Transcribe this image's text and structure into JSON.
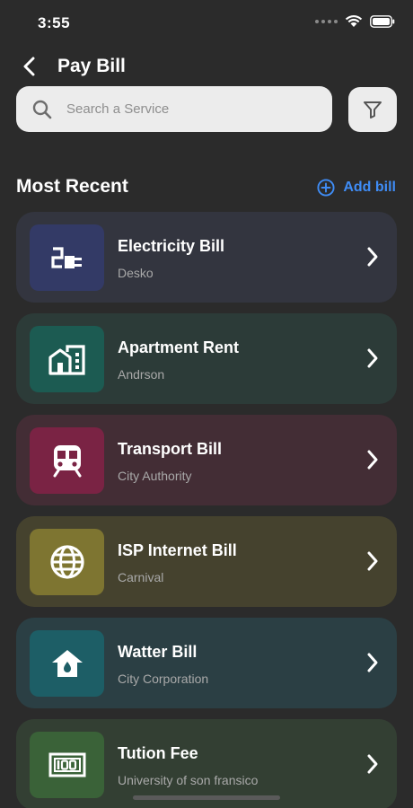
{
  "status": {
    "time": "3:55"
  },
  "header": {
    "title": "Pay Bill"
  },
  "search": {
    "placeholder": "Search a Service"
  },
  "section": {
    "title": "Most Recent",
    "add_label": "Add bill"
  },
  "colors": {
    "accent": "#3f8cf5",
    "background": "#2b2b2b"
  },
  "bills": [
    {
      "name": "Electricity Bill",
      "provider": "Desko",
      "icon": "electric-plug-icon",
      "card_color": "#33353f",
      "icon_color": "#333a66"
    },
    {
      "name": "Apartment Rent",
      "provider": "Andrson",
      "icon": "apartment-icon",
      "card_color": "#2c3b38",
      "icon_color": "#1c5b52"
    },
    {
      "name": "Transport Bill",
      "provider": "City Authority",
      "icon": "train-icon",
      "card_color": "#432d35",
      "icon_color": "#7a2344"
    },
    {
      "name": "ISP Internet Bill",
      "provider": "Carnival",
      "icon": "globe-icon",
      "card_color": "#45422e",
      "icon_color": "#7e7531"
    },
    {
      "name": "Watter Bill",
      "provider": "City Corporation",
      "icon": "water-house-icon",
      "card_color": "#2b3f44",
      "icon_color": "#1d5e66"
    },
    {
      "name": "Tution Fee",
      "provider": "University of son fransico",
      "icon": "school-fee-icon",
      "card_color": "#333f33",
      "icon_color": "#3a6238"
    }
  ]
}
